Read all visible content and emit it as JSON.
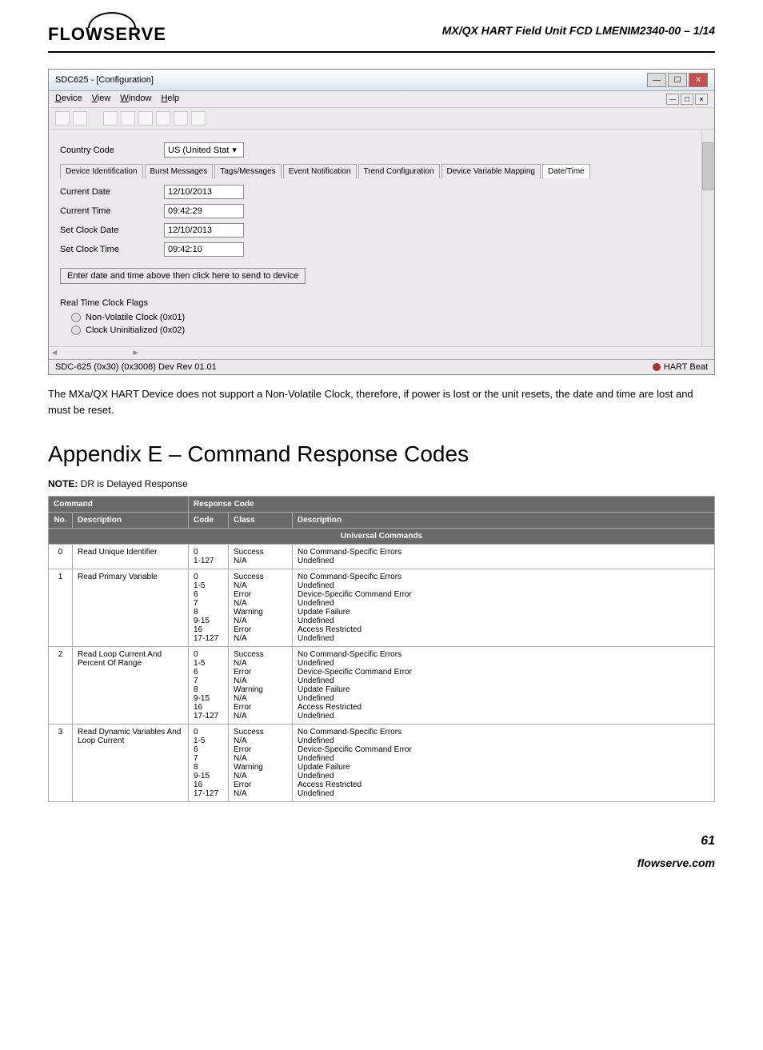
{
  "header": {
    "logo_text": "FLOWSERVE",
    "doc_title": "MX/QX HART Field Unit   FCD LMENIM2340-00 – 1/14"
  },
  "window": {
    "title": "SDC625 - [Configuration]",
    "menu": {
      "device": "Device",
      "view": "View",
      "window": "Window",
      "help": "Help"
    },
    "fields": {
      "country_code_label": "Country Code",
      "country_code_value": "US (United Stat",
      "current_date_label": "Current Date",
      "current_date_value": "12/10/2013",
      "current_time_label": "Current Time",
      "current_time_value": "09:42:29",
      "set_clock_date_label": "Set Clock Date",
      "set_clock_date_value": "12/10/2013",
      "set_clock_time_label": "Set Clock Time",
      "set_clock_time_value": "09:42:10"
    },
    "tabs": {
      "t1": "Device Identification",
      "t2": "Burst Messages",
      "t3": "Tags/Messages",
      "t4": "Event Notification",
      "t5": "Trend Configuration",
      "t6": "Device Variable Mapping",
      "t7": "Date/Time"
    },
    "send_button": "Enter date and time above then click here to send to device",
    "flags_heading": "Real Time Clock Flags",
    "flag1": "Non-Volatile Clock (0x01)",
    "flag2": "Clock Uninitialized (0x02)",
    "status_left": "SDC-625   (0x30)  (0x3008)  Dev Rev 01.01",
    "status_right": "HART Beat"
  },
  "caption": "The MXa/QX HART Device does not support a Non-Volatile Clock, therefore, if power is lost or the unit resets, the date and time are lost and must be reset.",
  "appendix_title": "Appendix E – Command Response Codes",
  "note_label": "NOTE:",
  "note_text": " DR is Delayed Response",
  "table": {
    "headers": {
      "command": "Command",
      "response": "Response Code",
      "no": "No.",
      "cmd_desc": "Description",
      "code": "Code",
      "class": "Class",
      "resp_desc": "Description"
    },
    "section1": "Universal Commands",
    "rows": [
      {
        "no": "0",
        "cmd_desc": "Read Unique Identifier",
        "codes": "0\n1-127",
        "classes": "Success\nN/A",
        "resp_desc": "No Command-Specific Errors\nUndefined"
      },
      {
        "no": "1",
        "cmd_desc": "Read Primary Variable",
        "codes": "0\n1-5\n6\n7\n8\n9-15\n16\n17-127",
        "classes": "Success\nN/A\nError\nN/A\nWarning\nN/A\nError\nN/A",
        "resp_desc": "No Command-Specific Errors\nUndefined\nDevice-Specific Command Error\nUndefined\nUpdate Failure\nUndefined\nAccess Restricted\nUndefined"
      },
      {
        "no": "2",
        "cmd_desc": "Read Loop Current And Percent Of Range",
        "codes": "0\n1-5\n6\n7\n8\n9-15\n16\n17-127",
        "classes": "Success\nN/A\nError\nN/A\nWarning\nN/A\nError\nN/A",
        "resp_desc": "No Command-Specific Errors\nUndefined\nDevice-Specific Command Error\nUndefined\nUpdate Failure\nUndefined\nAccess Restricted\nUndefined"
      },
      {
        "no": "3",
        "cmd_desc": "Read Dynamic Variables And Loop Current",
        "codes": "0\n1-5\n6\n7\n8\n9-15\n16\n17-127",
        "classes": "Success\nN/A\nError\nN/A\nWarning\nN/A\nError\nN/A",
        "resp_desc": "No Command-Specific Errors\nUndefined\nDevice-Specific Command Error\nUndefined\nUpdate Failure\nUndefined\nAccess Restricted\nUndefined"
      }
    ]
  },
  "page_num": "61",
  "footer_url": "flowserve.com"
}
